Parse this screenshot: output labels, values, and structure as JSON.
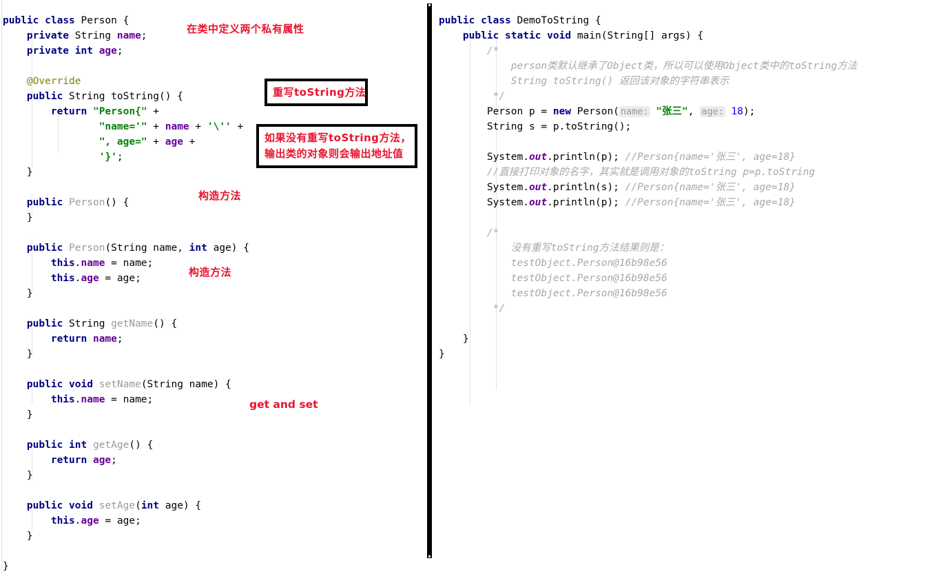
{
  "editor": {
    "left_pane": {
      "file_class": "Person",
      "lines": [
        [
          {
            "t": "kw",
            "s": "public"
          },
          {
            "t": "pln",
            "s": " "
          },
          {
            "t": "kw",
            "s": "class"
          },
          {
            "t": "pln",
            "s": " Person {"
          }
        ],
        [
          {
            "t": "pln",
            "s": "    "
          },
          {
            "t": "kw",
            "s": "private"
          },
          {
            "t": "pln",
            "s": " String "
          },
          {
            "t": "fld",
            "s": "name"
          },
          {
            "t": "pln",
            "s": ";"
          }
        ],
        [
          {
            "t": "pln",
            "s": "    "
          },
          {
            "t": "kw",
            "s": "private"
          },
          {
            "t": "pln",
            "s": " "
          },
          {
            "t": "kw",
            "s": "int"
          },
          {
            "t": "pln",
            "s": " "
          },
          {
            "t": "fld",
            "s": "age"
          },
          {
            "t": "pln",
            "s": ";"
          }
        ],
        [],
        [
          {
            "t": "pln",
            "s": "    "
          },
          {
            "t": "anno",
            "s": "@Override"
          }
        ],
        [
          {
            "t": "pln",
            "s": "    "
          },
          {
            "t": "kw",
            "s": "public"
          },
          {
            "t": "pln",
            "s": " String toString() {"
          }
        ],
        [
          {
            "t": "pln",
            "s": "        "
          },
          {
            "t": "kw",
            "s": "return"
          },
          {
            "t": "pln",
            "s": " "
          },
          {
            "t": "str",
            "s": "\"Person{\""
          },
          {
            "t": "pln",
            "s": " +"
          }
        ],
        [
          {
            "t": "pln",
            "s": "                "
          },
          {
            "t": "str",
            "s": "\"name='\""
          },
          {
            "t": "pln",
            "s": " + "
          },
          {
            "t": "fld",
            "s": "name"
          },
          {
            "t": "pln",
            "s": " + "
          },
          {
            "t": "str",
            "s": "'\\''"
          },
          {
            "t": "pln",
            "s": " +"
          }
        ],
        [
          {
            "t": "pln",
            "s": "                "
          },
          {
            "t": "str",
            "s": "\", age=\""
          },
          {
            "t": "pln",
            "s": " + "
          },
          {
            "t": "fld",
            "s": "age"
          },
          {
            "t": "pln",
            "s": " +"
          }
        ],
        [
          {
            "t": "pln",
            "s": "                "
          },
          {
            "t": "str",
            "s": "'}'"
          },
          {
            "t": "pln",
            "s": ";"
          }
        ],
        [
          {
            "t": "pln",
            "s": "    }"
          }
        ],
        [],
        [
          {
            "t": "pln",
            "s": "    "
          },
          {
            "t": "kw",
            "s": "public"
          },
          {
            "t": "pln",
            "s": " "
          },
          {
            "t": "mth",
            "s": "Person"
          },
          {
            "t": "pln",
            "s": "() {"
          }
        ],
        [
          {
            "t": "pln",
            "s": "    }"
          }
        ],
        [],
        [
          {
            "t": "pln",
            "s": "    "
          },
          {
            "t": "kw",
            "s": "public"
          },
          {
            "t": "pln",
            "s": " "
          },
          {
            "t": "mth",
            "s": "Person"
          },
          {
            "t": "pln",
            "s": "(String name, "
          },
          {
            "t": "kw",
            "s": "int"
          },
          {
            "t": "pln",
            "s": " age) {"
          }
        ],
        [
          {
            "t": "pln",
            "s": "        "
          },
          {
            "t": "kw",
            "s": "this"
          },
          {
            "t": "pln",
            "s": "."
          },
          {
            "t": "fld",
            "s": "name"
          },
          {
            "t": "pln",
            "s": " = name;"
          }
        ],
        [
          {
            "t": "pln",
            "s": "        "
          },
          {
            "t": "kw",
            "s": "this"
          },
          {
            "t": "pln",
            "s": "."
          },
          {
            "t": "fld",
            "s": "age"
          },
          {
            "t": "pln",
            "s": " = age;"
          }
        ],
        [
          {
            "t": "pln",
            "s": "    }"
          }
        ],
        [],
        [
          {
            "t": "pln",
            "s": "    "
          },
          {
            "t": "kw",
            "s": "public"
          },
          {
            "t": "pln",
            "s": " String "
          },
          {
            "t": "mth",
            "s": "getName"
          },
          {
            "t": "pln",
            "s": "() {"
          }
        ],
        [
          {
            "t": "pln",
            "s": "        "
          },
          {
            "t": "kw",
            "s": "return"
          },
          {
            "t": "pln",
            "s": " "
          },
          {
            "t": "fld",
            "s": "name"
          },
          {
            "t": "pln",
            "s": ";"
          }
        ],
        [
          {
            "t": "pln",
            "s": "    }"
          }
        ],
        [],
        [
          {
            "t": "pln",
            "s": "    "
          },
          {
            "t": "kw",
            "s": "public"
          },
          {
            "t": "pln",
            "s": " "
          },
          {
            "t": "kw",
            "s": "void"
          },
          {
            "t": "pln",
            "s": " "
          },
          {
            "t": "mth",
            "s": "setName"
          },
          {
            "t": "pln",
            "s": "(String name) {"
          }
        ],
        [
          {
            "t": "pln",
            "s": "        "
          },
          {
            "t": "kw",
            "s": "this"
          },
          {
            "t": "pln",
            "s": "."
          },
          {
            "t": "fld",
            "s": "name"
          },
          {
            "t": "pln",
            "s": " = name;"
          }
        ],
        [
          {
            "t": "pln",
            "s": "    }"
          }
        ],
        [],
        [
          {
            "t": "pln",
            "s": "    "
          },
          {
            "t": "kw",
            "s": "public"
          },
          {
            "t": "pln",
            "s": " "
          },
          {
            "t": "kw",
            "s": "int"
          },
          {
            "t": "pln",
            "s": " "
          },
          {
            "t": "mth",
            "s": "getAge"
          },
          {
            "t": "pln",
            "s": "() {"
          }
        ],
        [
          {
            "t": "pln",
            "s": "        "
          },
          {
            "t": "kw",
            "s": "return"
          },
          {
            "t": "pln",
            "s": " "
          },
          {
            "t": "fld",
            "s": "age"
          },
          {
            "t": "pln",
            "s": ";"
          }
        ],
        [
          {
            "t": "pln",
            "s": "    }"
          }
        ],
        [],
        [
          {
            "t": "pln",
            "s": "    "
          },
          {
            "t": "kw",
            "s": "public"
          },
          {
            "t": "pln",
            "s": " "
          },
          {
            "t": "kw",
            "s": "void"
          },
          {
            "t": "pln",
            "s": " "
          },
          {
            "t": "mth",
            "s": "setAge"
          },
          {
            "t": "pln",
            "s": "("
          },
          {
            "t": "kw",
            "s": "int"
          },
          {
            "t": "pln",
            "s": " age) {"
          }
        ],
        [
          {
            "t": "pln",
            "s": "        "
          },
          {
            "t": "kw",
            "s": "this"
          },
          {
            "t": "pln",
            "s": "."
          },
          {
            "t": "fld",
            "s": "age"
          },
          {
            "t": "pln",
            "s": " = age;"
          }
        ],
        [
          {
            "t": "pln",
            "s": "    }"
          }
        ],
        [],
        [
          {
            "t": "pln",
            "s": "}"
          }
        ]
      ]
    },
    "right_pane": {
      "file_class": "DemoToString",
      "lines": [
        [
          {
            "t": "kw",
            "s": "public"
          },
          {
            "t": "pln",
            "s": " "
          },
          {
            "t": "kw",
            "s": "class"
          },
          {
            "t": "pln",
            "s": " DemoToString {"
          }
        ],
        [
          {
            "t": "pln",
            "s": "    "
          },
          {
            "t": "kw",
            "s": "public"
          },
          {
            "t": "pln",
            "s": " "
          },
          {
            "t": "kw",
            "s": "static"
          },
          {
            "t": "pln",
            "s": " "
          },
          {
            "t": "kw",
            "s": "void"
          },
          {
            "t": "pln",
            "s": " main(String[] args) {"
          }
        ],
        [
          {
            "t": "pln",
            "s": "        "
          },
          {
            "t": "cmt",
            "s": "/*"
          }
        ],
        [
          {
            "t": "pln",
            "s": "            "
          },
          {
            "t": "cmt",
            "s": "person类默认继承了Object类，所以可以使用Object类中的toString方法"
          }
        ],
        [
          {
            "t": "pln",
            "s": "            "
          },
          {
            "t": "cmt",
            "s": "String toString() 返回该对象的字符串表示"
          }
        ],
        [
          {
            "t": "pln",
            "s": "         "
          },
          {
            "t": "cmt",
            "s": "*/"
          }
        ],
        [
          {
            "t": "pln",
            "s": "        Person p = "
          },
          {
            "t": "kw",
            "s": "new"
          },
          {
            "t": "pln",
            "s": " Person("
          },
          {
            "t": "hint",
            "s": "name:"
          },
          {
            "t": "pln",
            "s": " "
          },
          {
            "t": "str",
            "s": "\"张三\""
          },
          {
            "t": "pln",
            "s": ", "
          },
          {
            "t": "hint",
            "s": "age:"
          },
          {
            "t": "pln",
            "s": " "
          },
          {
            "t": "num",
            "s": "18"
          },
          {
            "t": "pln",
            "s": ");"
          }
        ],
        [
          {
            "t": "pln",
            "s": "        String s = p.toString();"
          }
        ],
        [],
        [
          {
            "t": "pln",
            "s": "        System."
          },
          {
            "t": "stat",
            "s": "out"
          },
          {
            "t": "pln",
            "s": ".println(p); "
          },
          {
            "t": "cmt",
            "s": "//Person{name='张三', age=18}"
          }
        ],
        [
          {
            "t": "pln",
            "s": "        "
          },
          {
            "t": "cmt",
            "s": "//直接打印对象的名字，其实就是调用对象的toString p=p.toString"
          }
        ],
        [
          {
            "t": "pln",
            "s": "        System."
          },
          {
            "t": "stat",
            "s": "out"
          },
          {
            "t": "pln",
            "s": ".println(s); "
          },
          {
            "t": "cmt",
            "s": "//Person{name='张三', age=18}"
          }
        ],
        [
          {
            "t": "pln",
            "s": "        System."
          },
          {
            "t": "stat",
            "s": "out"
          },
          {
            "t": "pln",
            "s": ".println(p); "
          },
          {
            "t": "cmt",
            "s": "//Person{name='张三', age=18}"
          }
        ],
        [],
        [
          {
            "t": "pln",
            "s": "        "
          },
          {
            "t": "cmt",
            "s": "/*"
          }
        ],
        [
          {
            "t": "pln",
            "s": "            "
          },
          {
            "t": "cmt",
            "s": "没有重写toString方法结果则是："
          }
        ],
        [
          {
            "t": "pln",
            "s": "            "
          },
          {
            "t": "cmt",
            "s": "testObject.Person@16b98e56"
          }
        ],
        [
          {
            "t": "pln",
            "s": "            "
          },
          {
            "t": "cmt",
            "s": "testObject.Person@16b98e56"
          }
        ],
        [
          {
            "t": "pln",
            "s": "            "
          },
          {
            "t": "cmt",
            "s": "testObject.Person@16b98e56"
          }
        ],
        [
          {
            "t": "pln",
            "s": "         "
          },
          {
            "t": "cmt",
            "s": "*/"
          }
        ],
        [],
        [
          {
            "t": "pln",
            "s": "    }"
          }
        ],
        [
          {
            "t": "pln",
            "s": "}"
          }
        ]
      ]
    }
  },
  "annotations": {
    "fields_note": "在类中定义两个私有属性",
    "constructor_note_1": "构造方法",
    "constructor_note_2": "构造方法",
    "get_set_note": "get and set",
    "callout_tostring": "重写toString方法",
    "callout_address": "如果没有重写toString方法，\n输出类的对象则会输出地址值",
    "accent_color": "#e8142d"
  }
}
